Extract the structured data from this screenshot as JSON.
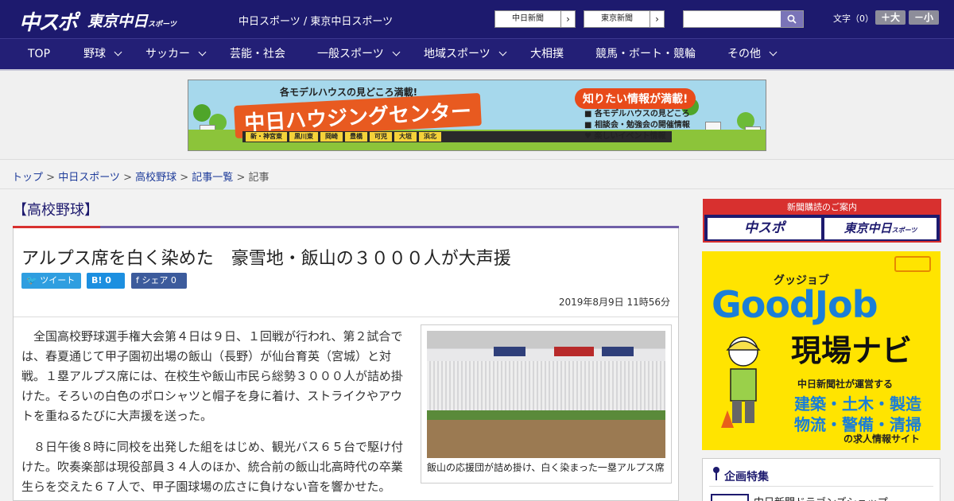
{
  "header": {
    "logo_chunichi": "中スポ",
    "logo_tokyo": "東京中日",
    "logo_tokyo_small": "スポーツ",
    "tagline": "中日スポーツ / 東京中日スポーツ",
    "paper_buttons": [
      "中日新聞",
      "東京新聞"
    ],
    "search_placeholder": "",
    "font_size_label": "文字（0）",
    "font_up": "＋大",
    "font_down": "－小"
  },
  "nav": {
    "items": [
      {
        "label": "TOP"
      },
      {
        "label": "野球"
      },
      {
        "label": "サッカー"
      },
      {
        "label": "芸能・社会"
      },
      {
        "label": "一般スポーツ"
      },
      {
        "label": "地域スポーツ"
      },
      {
        "label": "大相撲"
      },
      {
        "label": "競馬・ボート・競輪"
      },
      {
        "label": "その他"
      }
    ]
  },
  "banner": {
    "top_text": "各モデルハウスの見どころ満載!",
    "title": "中日ハウジングセンター",
    "bubble": "知りたい情報が満載!",
    "list": [
      "各モデルハウスの見どころ",
      "相談会・勉強会の開催情報",
      "楽しいイベント情報"
    ],
    "locations": [
      "新・神宮東",
      "黒川東",
      "岡崎",
      "豊橋",
      "可児",
      "大垣",
      "浜北"
    ]
  },
  "breadcrumb": {
    "items": [
      "トップ",
      "中日スポーツ",
      "高校野球",
      "記事一覧"
    ],
    "current": "記事",
    "sep": " > "
  },
  "article": {
    "section": "【高校野球】",
    "headline": "アルプス席を白く染めた　豪雪地・飯山の３０００人が大声援",
    "share_tweet": "ツイート",
    "share_hatena": "B! 0",
    "share_facebook": "シェア 0",
    "date": "2019年8月9日 11時56分",
    "paragraphs": [
      "全国高校野球選手権大会第４日は９日、１回戦が行われ、第２試合では、春夏通じて甲子園初出場の飯山（長野）が仙台育英（宮城）と対戦。１塁アルプス席には、在校生や飯山市民ら総勢３０００人が詰め掛けた。そろいの白色のポロシャツと帽子を身に着け、ストライクやアウトを重ねるたびに大声援を送った。",
      "８日午後８時に同校を出発した組をはじめ、観光バス６５台で駆け付けた。吹奏楽部は現役部員３４人のほか、統合前の飯山北高時代の卒業生らを交えた６７人で、甲子園球場の広さに負けない音を響かせた。"
    ],
    "photo_caption": "飯山の応援団が詰め掛け、白く染まった一塁アルプス席"
  },
  "sidebar": {
    "subscribe_head": "新聞購読のご案内",
    "subscribe_chunichi": "中スポ",
    "subscribe_tokyo": "東京中日",
    "subscribe_tokyo_small": "スポーツ",
    "ad": {
      "gutt": "グッジョブ",
      "good": "GoodJob",
      "navi": "現場ナビ",
      "sub": "中日新聞社が運営する",
      "line1": "建築・土木・製造",
      "line2": "物流・警備・清掃",
      "site": "の求人情報サイト"
    },
    "feature_head": "企画特集",
    "feature_item": "中日新聞ドラゴンズショップ"
  },
  "colors": {
    "header_bg": "#1d1a6e",
    "accent_red": "#d8302f",
    "link": "#1d3b9a"
  }
}
